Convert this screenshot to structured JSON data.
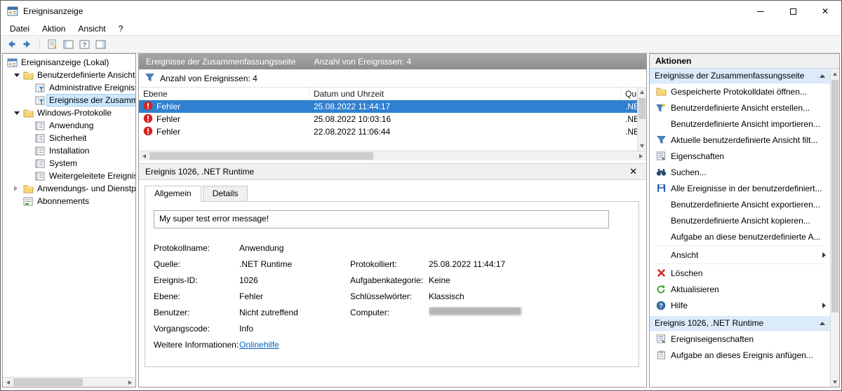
{
  "window": {
    "title": "Ereignisanzeige"
  },
  "glyphs": {
    "close": "✕"
  },
  "menubar": {
    "items": [
      {
        "label": "Datei"
      },
      {
        "label": "Aktion"
      },
      {
        "label": "Ansicht"
      },
      {
        "label": "?"
      }
    ]
  },
  "tree": {
    "items": [
      {
        "label": "Ereignisanzeige (Lokal)"
      },
      {
        "label": "Benutzerdefinierte Ansichten"
      },
      {
        "label": "Administrative Ereignisse"
      },
      {
        "label": "Ereignisse der Zusammer"
      },
      {
        "label": "Windows-Protokolle"
      },
      {
        "label": "Anwendung"
      },
      {
        "label": "Sicherheit"
      },
      {
        "label": "Installation"
      },
      {
        "label": "System"
      },
      {
        "label": "Weitergeleitete Ereignisse"
      },
      {
        "label": "Anwendungs- und Dienstpro"
      },
      {
        "label": "Abonnements"
      }
    ]
  },
  "events": {
    "pane_title": "Ereignisse der Zusammenfassungsseite",
    "pane_count": "Anzahl von Ereignissen: 4",
    "filter_text": "Anzahl von Ereignissen: 4",
    "columns": {
      "level": "Ebene",
      "datetime": "Datum und Uhrzeit",
      "source": "Quelle"
    },
    "rows": [
      {
        "level": "Fehler",
        "datetime": "25.08.2022 11:44:17",
        "source": ".NET R"
      },
      {
        "level": "Fehler",
        "datetime": "25.08.2022 10:03:16",
        "source": ".NET R"
      },
      {
        "level": "Fehler",
        "datetime": "22.08.2022 11:06:44",
        "source": ".NET R"
      }
    ]
  },
  "detail": {
    "title": "Ereignis 1026, .NET Runtime",
    "tabs": [
      {
        "label": "Allgemein"
      },
      {
        "label": "Details"
      }
    ],
    "message": "My super test error message!",
    "rows": [
      {
        "l1": "Protokollname:",
        "v1": "Anwendung",
        "l2": "",
        "v2": ""
      },
      {
        "l1": "Quelle:",
        "v1": ".NET Runtime",
        "l2": "Protokolliert:",
        "v2": "25.08.2022 11:44:17"
      },
      {
        "l1": "Ereignis-ID:",
        "v1": "1026",
        "l2": "Aufgabenkategorie:",
        "v2": "Keine"
      },
      {
        "l1": "Ebene:",
        "v1": "Fehler",
        "l2": "Schlüsselwörter:",
        "v2": "Klassisch"
      },
      {
        "l1": "Benutzer:",
        "v1": "Nicht zutreffend",
        "l2": "Computer:",
        "v2": ""
      },
      {
        "l1": "Vorgangscode:",
        "v1": "Info",
        "l2": "",
        "v2": ""
      },
      {
        "l1": "Weitere Informationen:",
        "v1": "Onlinehilfe",
        "l2": "",
        "v2": ""
      }
    ]
  },
  "actions": {
    "title": "Aktionen",
    "sections": [
      {
        "header": "Ereignisse der Zusammenfassungsseite",
        "items": [
          {
            "label": "Gespeicherte Protokolldatei öffnen..."
          },
          {
            "label": "Benutzerdefinierte Ansicht erstellen..."
          },
          {
            "label": "Benutzerdefinierte Ansicht importieren..."
          },
          {
            "label": "Aktuelle benutzerdefinierte Ansicht filt..."
          },
          {
            "label": "Eigenschaften"
          },
          {
            "label": "Suchen..."
          },
          {
            "label": "Alle Ereignisse in der benutzerdefiniert..."
          },
          {
            "label": "Benutzerdefinierte Ansicht exportieren..."
          },
          {
            "label": "Benutzerdefinierte Ansicht kopieren..."
          },
          {
            "label": "Aufgabe an diese benutzerdefinierte A..."
          },
          {
            "label": "Ansicht"
          },
          {
            "label": "Löschen"
          },
          {
            "label": "Aktualisieren"
          },
          {
            "label": "Hilfe"
          }
        ]
      },
      {
        "header": "Ereignis 1026, .NET Runtime",
        "items": [
          {
            "label": "Ereigniseigenschaften"
          },
          {
            "label": "Aufgabe an dieses Ereignis anfügen..."
          }
        ]
      }
    ]
  },
  "colors": {
    "selection": "#2f80d0",
    "section_header": "#dcebfa",
    "error": "#dc1f1f",
    "link": "#0563c1"
  }
}
